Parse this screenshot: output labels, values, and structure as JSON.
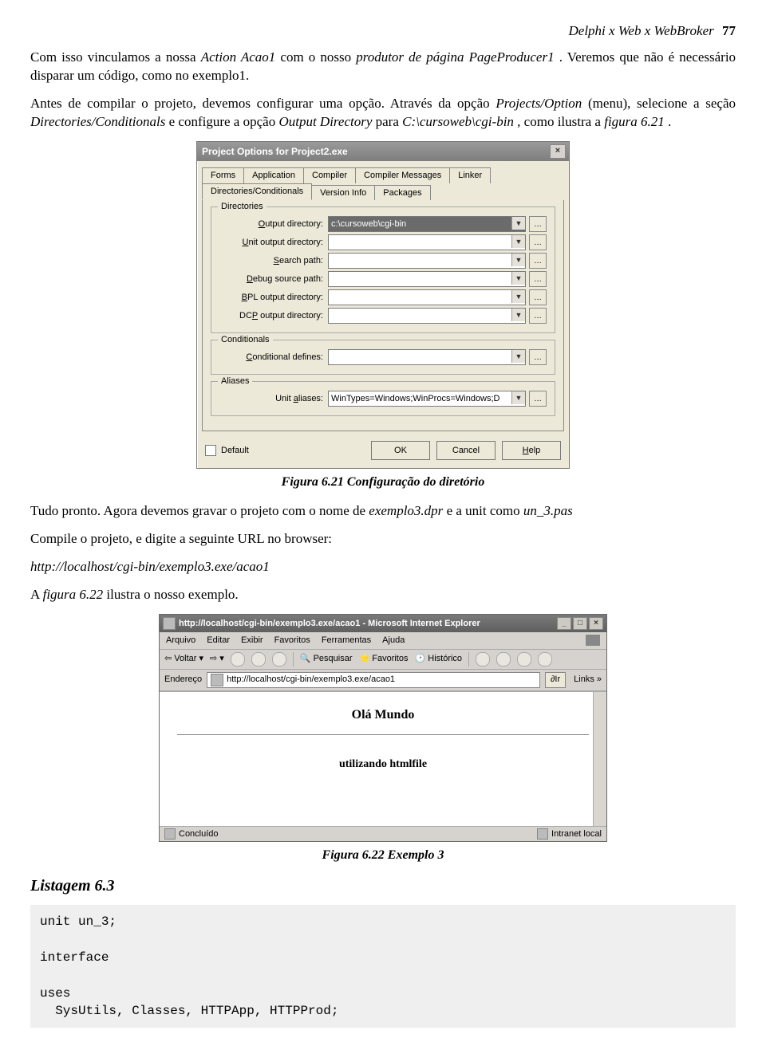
{
  "header": {
    "title": "Delphi x Web x WebBroker",
    "page": "77"
  },
  "para1_a": "Com isso vinculamos a nossa ",
  "para1_i1": "Action Acao1",
  "para1_b": " com o nosso ",
  "para1_i2": "produtor de página PageProducer1",
  "para1_c": ". Veremos que não é necessário disparar um código, como no exemplo1.",
  "para2_a": "Antes de compilar o projeto, devemos configurar uma opção. Através da opção ",
  "para2_i1": "Projects/Option",
  "para2_b": " (menu), selecione a seção ",
  "para2_i2": "Directories/Conditionals",
  "para2_c": " e configure a opção ",
  "para2_i3": "Output Directory",
  "para2_d": " para ",
  "para2_i4": "C:\\cursoweb\\cgi-bin",
  "para2_e": ", como ilustra a ",
  "para2_i5": "figura 6.21",
  "para2_f": ".",
  "dialog": {
    "title": "Project Options for Project2.exe",
    "tabs_row1": [
      "Forms",
      "Application",
      "Compiler",
      "Compiler Messages",
      "Linker"
    ],
    "tabs_row2": [
      "Directories/Conditionals",
      "Version Info",
      "Packages"
    ],
    "groups": {
      "directories": {
        "title": "Directories",
        "fields": [
          {
            "label": "Output directory:",
            "value": "c:\\cursoweb\\cgi-bin",
            "hot": "O",
            "selected": true
          },
          {
            "label": "Unit output directory:",
            "value": "",
            "hot": "U"
          },
          {
            "label": "Search path:",
            "value": "",
            "hot": "S"
          },
          {
            "label": "Debug source path:",
            "value": "",
            "hot": "D"
          },
          {
            "label": "BPL output directory:",
            "value": "",
            "hot": "B"
          },
          {
            "label": "DCP output directory:",
            "value": "",
            "hot": "P"
          }
        ]
      },
      "conditionals": {
        "title": "Conditionals",
        "field": {
          "label": "Conditional defines:",
          "value": "",
          "hot": "C"
        }
      },
      "aliases": {
        "title": "Aliases",
        "field": {
          "label": "Unit aliases:",
          "value": "WinTypes=Windows;WinProcs=Windows;D",
          "hot": "a"
        }
      }
    },
    "default_label": "Default",
    "ok": "OK",
    "cancel": "Cancel",
    "help": "Help"
  },
  "fig1_caption": "Figura 6.21 Configuração do diretório",
  "para3_a": "Tudo pronto. Agora devemos gravar o projeto com o nome de ",
  "para3_i1": "exemplo3.dpr",
  "para3_b": " e a unit como ",
  "para3_i2": "un_3.pas",
  "para4": "Compile o projeto, e digite a seguinte URL no browser:",
  "url_line": "http://localhost/cgi-bin/exemplo3.exe/acao1",
  "para5_a": "A ",
  "para5_i1": "figura 6.22",
  "para5_b": " ilustra o nosso exemplo.",
  "browser": {
    "title": "http://localhost/cgi-bin/exemplo3.exe/acao1 - Microsoft Internet Explorer",
    "menu": [
      "Arquivo",
      "Editar",
      "Exibir",
      "Favoritos",
      "Ferramentas",
      "Ajuda"
    ],
    "toolbar": {
      "back": "Voltar",
      "search": "Pesquisar",
      "fav": "Favoritos",
      "hist": "Histórico"
    },
    "addr_label": "Endereço",
    "addr_url": "http://localhost/cgi-bin/exemplo3.exe/acao1",
    "go": "Ir",
    "links": "Links »",
    "content_heading": "Olá Mundo",
    "content_sub": "utilizando htmlfile",
    "status_left": "Concluído",
    "status_right": "Intranet local"
  },
  "fig2_caption": "Figura 6.22 Exemplo 3",
  "listing_head": "Listagem 6.3",
  "code": "unit un_3;\n\ninterface\n\nuses\n  SysUtils, Classes, HTTPApp, HTTPProd;"
}
